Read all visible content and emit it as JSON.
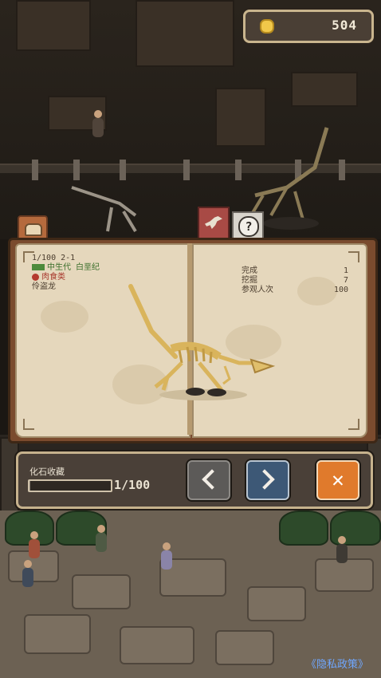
{
  "header": {
    "coins": "504",
    "coin_icon": "coin-icon"
  },
  "book": {
    "tabs": [
      {
        "icon": "helmet-icon"
      },
      {
        "icon": "dinosaur-icon"
      },
      {
        "icon": "question-icon",
        "label": "?"
      }
    ],
    "entry": {
      "index": "1/100 2-1",
      "era": "中生代 白垩纪",
      "diet": "肉食类",
      "name": "伶盗龙"
    },
    "stats": [
      {
        "label": "完成",
        "value": "1"
      },
      {
        "label": "挖掘",
        "value": "7"
      },
      {
        "label": "参观人次",
        "value": "100"
      }
    ]
  },
  "panel": {
    "collection_label": "化石收藏",
    "progress": 0.01,
    "count": "1/100",
    "prev_icon": "chevron-left-icon",
    "next_icon": "chevron-right-icon",
    "close_label": "✕"
  },
  "footer": {
    "privacy": "《隐私政策》"
  },
  "colors": {
    "accent": "#e07a2c",
    "next": "#3d5876",
    "page": "#e5d7bc",
    "frame": "#c6b28d"
  }
}
